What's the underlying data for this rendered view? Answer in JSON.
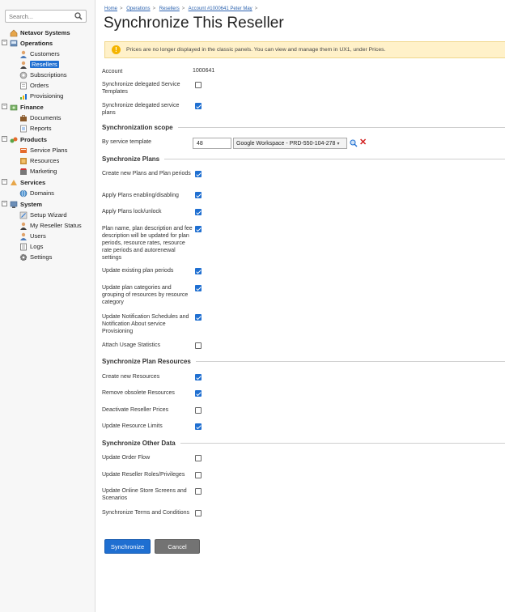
{
  "sidebar": {
    "search_placeholder": "Search...",
    "root": "Netavor Systems",
    "operations": {
      "label": "Operations",
      "items": [
        "Customers",
        "Resellers",
        "Subscriptions",
        "Orders",
        "Provisioning"
      ],
      "selected": "Resellers"
    },
    "finance": {
      "label": "Finance",
      "items": [
        "Documents",
        "Reports"
      ]
    },
    "products": {
      "label": "Products",
      "items": [
        "Service Plans",
        "Resources",
        "Marketing"
      ]
    },
    "services": {
      "label": "Services",
      "items": [
        "Domains"
      ]
    },
    "system": {
      "label": "System",
      "items": [
        "Setup Wizard",
        "My Reseller Status",
        "Users",
        "Logs",
        "Settings"
      ]
    }
  },
  "breadcrumb": [
    "Home",
    "Operations",
    "Resellers",
    "Account #1000641 Peter May"
  ],
  "title": "Synchronize This Reseller",
  "alert": "Prices are no longer displayed in the classic panels. You can view and manage them in UX1, under Prices.",
  "account": {
    "label": "Account",
    "value": "1000641"
  },
  "top_options": [
    {
      "label": "Synchronize delegated Service Templates",
      "checked": false
    },
    {
      "label": "Synchronize delegated service plans",
      "checked": true
    }
  ],
  "scope": {
    "section": "Synchronization scope",
    "label": "By service template",
    "template_id": "48",
    "template_name": "Google Workspace - PRD-550-104-278"
  },
  "plans": {
    "section": "Synchronize Plans",
    "options": [
      {
        "label": "Create new Plans and Plan periods",
        "checked": true
      },
      {
        "label": "Apply Plans enabling/disabling",
        "checked": true
      },
      {
        "label": "Apply Plans lock/unlock",
        "checked": true
      },
      {
        "label": "Plan name, plan description and fee description will be updated for plan periods, resource rates, resource rate periods and autorenewal settings",
        "checked": true
      },
      {
        "label": "Update existing plan periods",
        "checked": true
      },
      {
        "label": "Update plan categories and grouping of resources by resource category",
        "checked": true
      },
      {
        "label": "Update Notification Schedules and Notification About service Provisioning",
        "checked": true
      },
      {
        "label": "Attach Usage Statistics",
        "checked": false
      }
    ]
  },
  "resources": {
    "section": "Synchronize Plan Resources",
    "options": [
      {
        "label": "Create new Resources",
        "checked": true
      },
      {
        "label": "Remove obsolete Resources",
        "checked": true
      },
      {
        "label": "Deactivate Reseller Prices",
        "checked": false
      },
      {
        "label": "Update Resource Limits",
        "checked": true
      }
    ]
  },
  "other": {
    "section": "Synchronize Other Data",
    "options": [
      {
        "label": "Update Order Flow",
        "checked": false
      },
      {
        "label": "Update Reseller Roles/Privileges",
        "checked": false
      },
      {
        "label": "Update Online Store Screens and Scenarios",
        "checked": false
      },
      {
        "label": "Synchronize Terms and Conditions",
        "checked": false
      }
    ]
  },
  "buttons": {
    "synchronize": "Synchronize",
    "cancel": "Cancel"
  },
  "colors": {
    "accent": "#1f6fd1",
    "alert_bg": "#fff1c9",
    "warn": "#f4b400"
  }
}
